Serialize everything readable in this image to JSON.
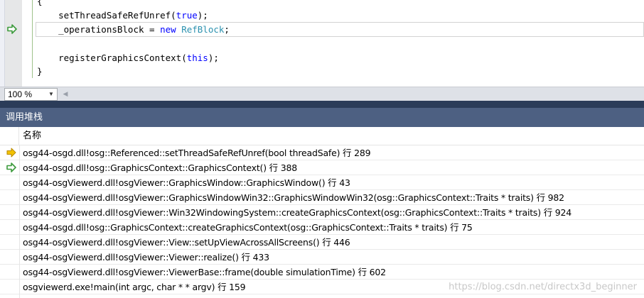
{
  "editor": {
    "code_lines": [
      {
        "parts": [
          {
            "t": "{",
            "c": "plain"
          }
        ]
      },
      {
        "parts": [
          {
            "t": "    setThreadSafeRefUnref(",
            "c": "plain"
          },
          {
            "t": "true",
            "c": "kw"
          },
          {
            "t": ");",
            "c": "plain"
          }
        ]
      },
      {
        "parts": [
          {
            "t": "    _operationsBlock = ",
            "c": "plain"
          },
          {
            "t": "new",
            "c": "kw"
          },
          {
            "t": " ",
            "c": "plain"
          },
          {
            "t": "RefBlock",
            "c": "ty"
          },
          {
            "t": ";",
            "c": "plain"
          }
        ]
      },
      {
        "parts": [
          {
            "t": "",
            "c": "plain"
          }
        ]
      },
      {
        "parts": [
          {
            "t": "    registerGraphicsContext(",
            "c": "plain"
          },
          {
            "t": "this",
            "c": "kw"
          },
          {
            "t": ");",
            "c": "plain"
          }
        ]
      },
      {
        "parts": [
          {
            "t": "}",
            "c": "plain"
          }
        ]
      }
    ],
    "current_line_marker_icon": "green-return-arrow-icon"
  },
  "zoom": {
    "value": "100 %",
    "dropdown_icon": "chevron-down-icon",
    "scroll_left_icon": "scroll-left-icon"
  },
  "call_stack": {
    "title": "调用堆栈",
    "column_name": "名称",
    "rows": [
      {
        "marker": "current",
        "text": "osg44-osgd.dll!osg::Referenced::setThreadSafeRefUnref(bool threadSafe) 行 289"
      },
      {
        "marker": "return",
        "text": "osg44-osgd.dll!osg::GraphicsContext::GraphicsContext() 行 388"
      },
      {
        "marker": "none",
        "text": "osg44-osgViewerd.dll!osgViewer::GraphicsWindow::GraphicsWindow() 行 43"
      },
      {
        "marker": "none",
        "text": "osg44-osgViewerd.dll!osgViewer::GraphicsWindowWin32::GraphicsWindowWin32(osg::GraphicsContext::Traits * traits) 行 982"
      },
      {
        "marker": "none",
        "text": "osg44-osgViewerd.dll!osgViewer::Win32WindowingSystem::createGraphicsContext(osg::GraphicsContext::Traits * traits) 行 924"
      },
      {
        "marker": "none",
        "text": "osg44-osgd.dll!osg::GraphicsContext::createGraphicsContext(osg::GraphicsContext::Traits * traits) 行 75"
      },
      {
        "marker": "none",
        "text": "osg44-osgViewerd.dll!osgViewer::View::setUpViewAcrossAllScreens() 行 446"
      },
      {
        "marker": "none",
        "text": "osg44-osgViewerd.dll!osgViewer::Viewer::realize() 行 433"
      },
      {
        "marker": "none",
        "text": "osg44-osgViewerd.dll!osgViewer::ViewerBase::frame(double simulationTime) 行 602"
      },
      {
        "marker": "none",
        "text": "osgviewerd.exe!main(int argc, char * * argv) 行 159"
      }
    ]
  },
  "watermark": "https://blog.csdn.net/directx3d_beginner",
  "colors": {
    "current_arrow": "#f2c200",
    "return_arrow": "#3c9a3c",
    "keyword": "#0000ff",
    "type": "#2b91af",
    "titlebar": "#4d6082"
  }
}
